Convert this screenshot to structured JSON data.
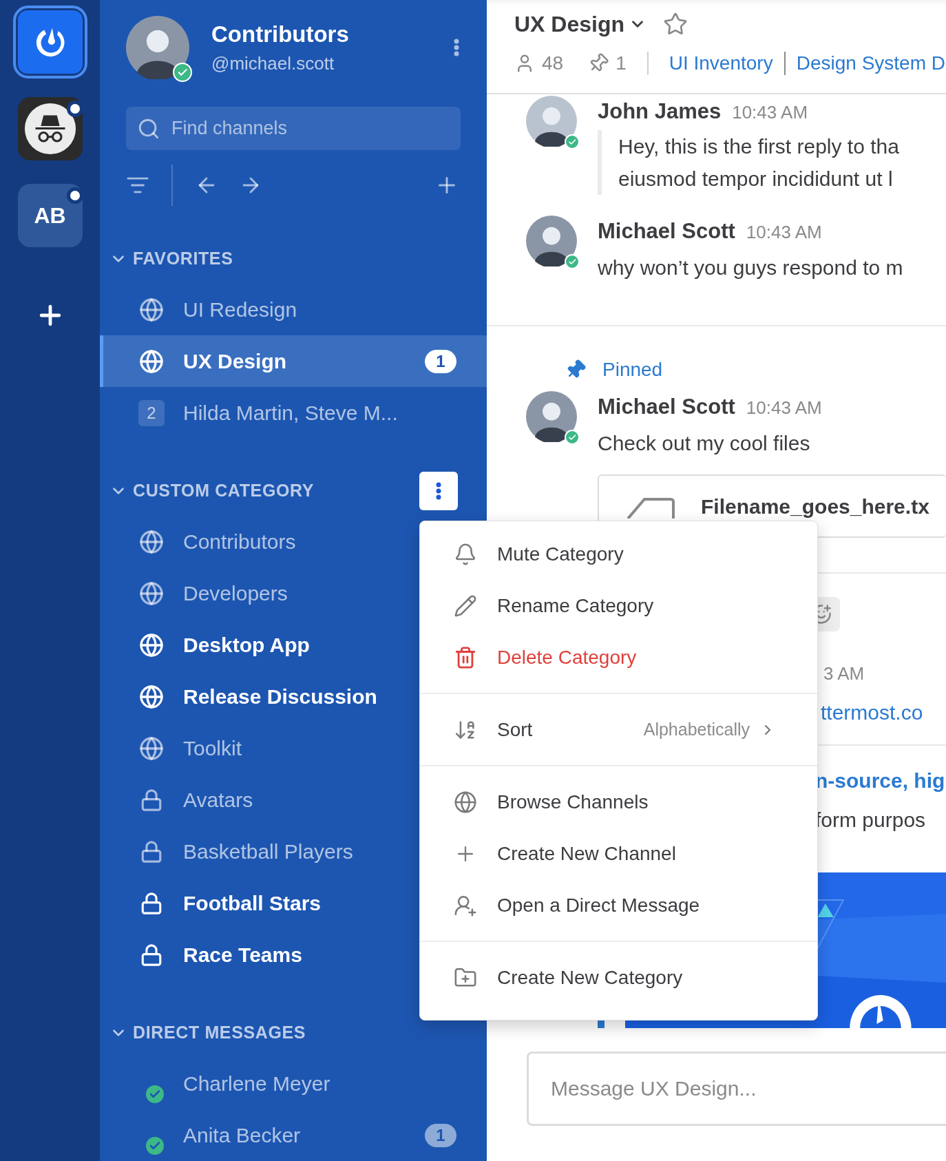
{
  "team_sidebar": {
    "teams": [
      {
        "kind": "logo",
        "selected": true,
        "unread": false
      },
      {
        "kind": "incognito",
        "selected": false,
        "unread": true
      },
      {
        "kind": "initials",
        "label": "AB",
        "selected": false,
        "unread": true
      }
    ]
  },
  "sidebar_header": {
    "title": "Contributors",
    "username": "@michael.scott"
  },
  "search": {
    "placeholder": "Find channels"
  },
  "sections": [
    {
      "title": "FAVORITES",
      "expanded": true,
      "menu_open": false,
      "channels": [
        {
          "kind": "public",
          "name": "UI Redesign",
          "unread": false,
          "selected": false
        },
        {
          "kind": "public",
          "name": "UX Design",
          "unread": true,
          "selected": true,
          "badge": "1"
        },
        {
          "kind": "group",
          "name": "Hilda Martin, Steve M...",
          "count": "2",
          "unread": false,
          "selected": false
        }
      ]
    },
    {
      "title": "CUSTOM CATEGORY",
      "expanded": true,
      "menu_open": true,
      "channels": [
        {
          "kind": "public",
          "name": "Contributors",
          "unread": false,
          "selected": false
        },
        {
          "kind": "public",
          "name": "Developers",
          "unread": false,
          "selected": false
        },
        {
          "kind": "public",
          "name": "Desktop App",
          "unread": true,
          "selected": false
        },
        {
          "kind": "public",
          "name": "Release Discussion",
          "unread": true,
          "selected": false
        },
        {
          "kind": "public",
          "name": "Toolkit",
          "unread": false,
          "selected": false
        },
        {
          "kind": "private",
          "name": "Avatars",
          "unread": false,
          "selected": false
        },
        {
          "kind": "private",
          "name": "Basketball Players",
          "unread": false,
          "selected": false
        },
        {
          "kind": "private",
          "name": "Football Stars",
          "unread": true,
          "selected": false
        },
        {
          "kind": "private",
          "name": "Race Teams",
          "unread": true,
          "selected": false
        }
      ]
    },
    {
      "title": "DIRECT MESSAGES",
      "expanded": true,
      "menu_open": false,
      "channels": [
        {
          "kind": "dm",
          "name": "Charlene Meyer",
          "unread": false,
          "selected": false,
          "online": true
        },
        {
          "kind": "dm",
          "name": "Anita Becker",
          "unread": false,
          "selected": false,
          "online": true,
          "badge": "1"
        }
      ]
    }
  ],
  "channel_header": {
    "title": "UX Design",
    "members": "48",
    "pinned": "1",
    "links": [
      "UI Inventory",
      "Design System D"
    ]
  },
  "messages": [
    {
      "kind": "reply",
      "author": "John James",
      "time": "10:43 AM",
      "lines": [
        "Hey, this is the first reply to tha",
        "eiusmod tempor incididunt ut l"
      ]
    },
    {
      "kind": "plain",
      "author": "Michael Scott",
      "time": "10:43 AM",
      "lines": [
        "why won’t you guys respond to m"
      ]
    },
    {
      "kind": "pinned",
      "pinned_label": "Pinned",
      "author": "Michael Scott",
      "time": "10:43 AM",
      "lines": [
        "Check out my cool files"
      ]
    }
  ],
  "file": {
    "name": "Filename_goes_here.tx"
  },
  "covered_post": {
    "time": "3 AM",
    "link": "ttermost.co",
    "preview_title": "n-source, hig",
    "preview_text": "form purpos"
  },
  "composer": {
    "placeholder": "Message UX Design..."
  },
  "context_menu": {
    "groups": [
      [
        {
          "kind": "action",
          "label": "Mute Category"
        },
        {
          "kind": "action",
          "label": "Rename Category"
        },
        {
          "kind": "danger",
          "label": "Delete Category"
        }
      ],
      [
        {
          "kind": "submenu",
          "label": "Sort",
          "value": "Alphabetically"
        }
      ],
      [
        {
          "kind": "action",
          "label": "Browse Channels"
        },
        {
          "kind": "action",
          "label": "Create New Channel"
        },
        {
          "kind": "action",
          "label": "Open a Direct Message"
        }
      ],
      [
        {
          "kind": "action",
          "label": "Create New Category"
        }
      ]
    ]
  }
}
